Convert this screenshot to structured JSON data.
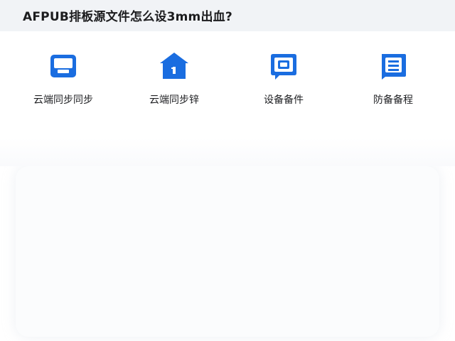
{
  "page": {
    "title": "AFPUB排板源文件怎么设3mm出血?"
  },
  "tiles": [
    {
      "label": "云端同步同步",
      "icon": "tray-icon"
    },
    {
      "label": "云端同步锌",
      "icon": "home-icon"
    },
    {
      "label": "设备备件",
      "icon": "device-icon"
    },
    {
      "label": "防备备程",
      "icon": "document-icon"
    }
  ],
  "colors": {
    "accent": "#1a6de0",
    "header_bg": "#f1f3f6",
    "text": "#202124"
  }
}
